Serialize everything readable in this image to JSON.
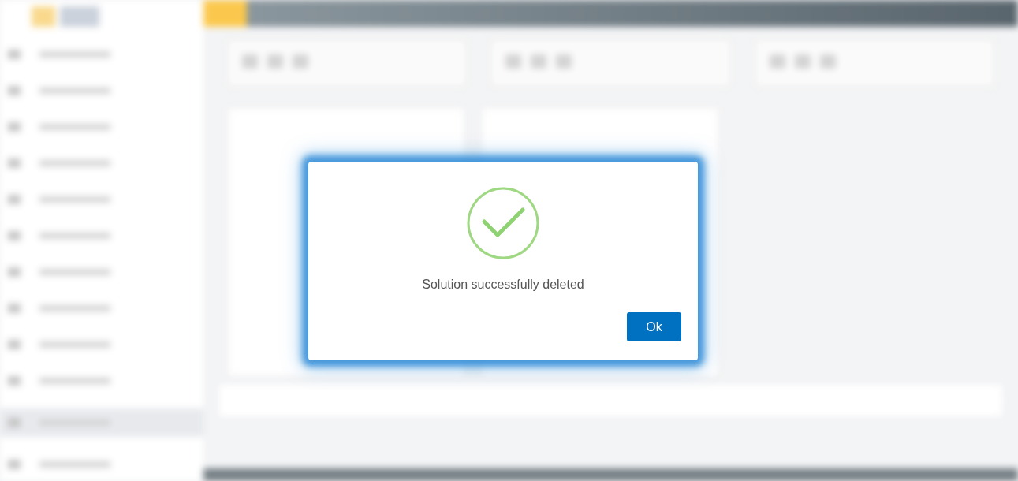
{
  "dialog": {
    "kind": "success",
    "message": "Solution successfully deleted",
    "buttons": [
      {
        "label": "Ok"
      }
    ]
  }
}
